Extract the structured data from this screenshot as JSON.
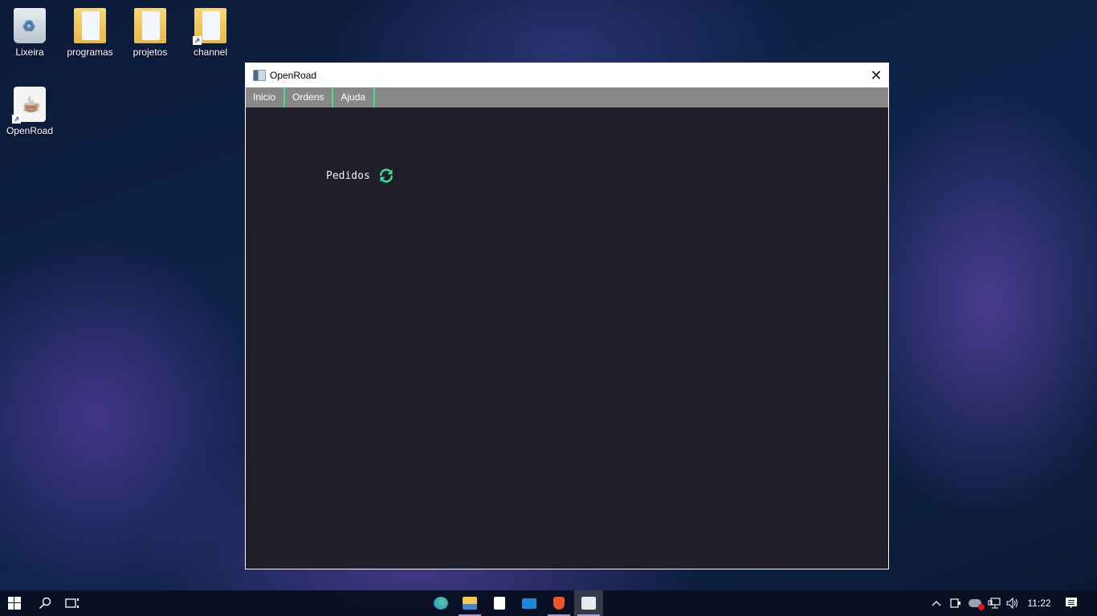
{
  "desktop": {
    "icons": [
      {
        "label": "Lixeira",
        "icon": "recycle-bin-icon"
      },
      {
        "label": "programas",
        "icon": "folder-icon"
      },
      {
        "label": "projetos",
        "icon": "folder-icon"
      },
      {
        "label": "channel",
        "icon": "folder-shortcut-icon"
      },
      {
        "label": "OpenRoad",
        "icon": "java-shortcut-icon"
      }
    ]
  },
  "window": {
    "title": "OpenRoad",
    "close_glyph": "✕",
    "menu": [
      {
        "label": "Inicio"
      },
      {
        "label": "Ordens"
      },
      {
        "label": "Ajuda"
      }
    ],
    "content": {
      "section_label": "Pedidos",
      "refresh_icon": "refresh-icon"
    },
    "colors": {
      "menu_bg": "#888888",
      "menu_separator": "#3fe08f",
      "content_bg": "#1f1e29",
      "accent": "#3fe08f"
    }
  },
  "taskbar": {
    "apps": [
      "edge",
      "file-explorer",
      "microsoft-store",
      "mail",
      "brave",
      "java-openroad"
    ],
    "tray": [
      "show-hidden-icons",
      "meet-now",
      "onedrive-error",
      "network",
      "volume"
    ],
    "clock": "11:22"
  }
}
